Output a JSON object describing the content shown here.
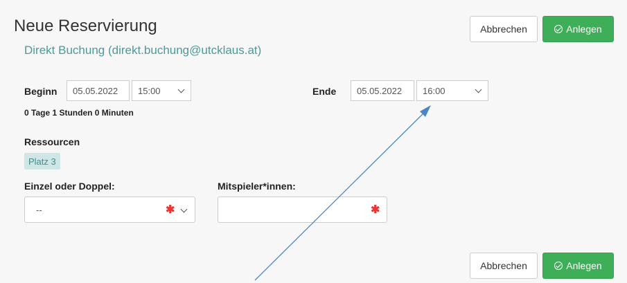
{
  "header": {
    "title": "Neue Reservierung",
    "subtitle": "Direkt Buchung (direkt.buchung@utcklaus.at)",
    "cancel_label": "Abbrechen",
    "create_label": "Anlegen"
  },
  "begin": {
    "label": "Beginn",
    "date": "05.05.2022",
    "time": "15:00"
  },
  "end": {
    "label": "Ende",
    "date": "05.05.2022",
    "time": "16:00"
  },
  "duration": "0 Tage 1 Stunden 0 Minuten",
  "resources": {
    "label": "Ressourcen",
    "items": [
      "Platz 3"
    ]
  },
  "single_double": {
    "label": "Einzel oder Doppel:",
    "value": "--",
    "required_mark": "✱"
  },
  "players": {
    "label": "Mitspieler*innen:",
    "value": "",
    "required_mark": "✱"
  },
  "footer": {
    "cancel_label": "Abbrechen",
    "create_label": "Anlegen"
  },
  "colors": {
    "accent": "#4a9a9b",
    "create_button": "#3fae58",
    "annotation_arrow": "#4a86c5"
  }
}
